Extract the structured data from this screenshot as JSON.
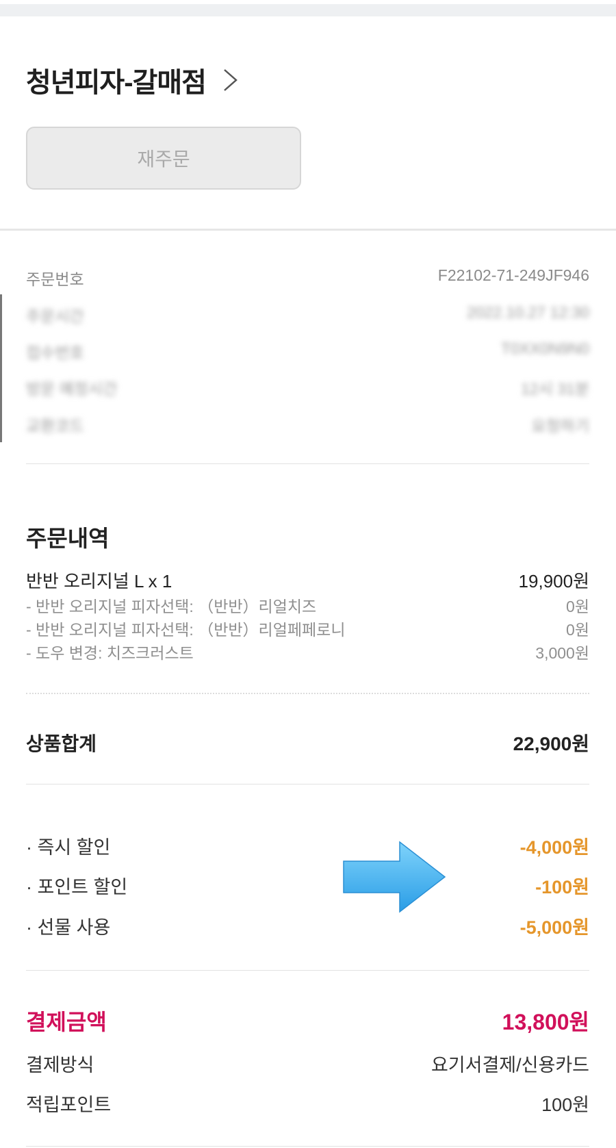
{
  "store": {
    "name": "청년피자-갈매점"
  },
  "reorder_label": "재주문",
  "order_info": [
    {
      "label": "주문번호",
      "value": "F22102-71-249JF946",
      "blurred": false
    },
    {
      "label": "주문시간",
      "value": "2022.10.27 12:30",
      "blurred": true
    },
    {
      "label": "접수번호",
      "value": "T0XX0N9N0",
      "blurred": true
    },
    {
      "label": "방문 예정시간",
      "value": "12시 31분",
      "blurred": true
    },
    {
      "label": "교환코드",
      "value": "요청하기",
      "blurred": true
    }
  ],
  "order_details": {
    "title": "주문내역",
    "item": {
      "name": "반반 오리지널 L x 1",
      "price": "19,900원"
    },
    "options": [
      {
        "label": "- 반반 오리지널 피자선택: （반반）리얼치즈",
        "price": "0원"
      },
      {
        "label": "- 반반 오리지널 피자선택: （반반）리얼페페로니",
        "price": "0원"
      },
      {
        "label": "- 도우 변경: 치즈크러스트",
        "price": "3,000원"
      }
    ]
  },
  "subtotal": {
    "label": "상품합계",
    "value": "22,900원"
  },
  "discounts": [
    {
      "label": "· 즉시 할인",
      "value": "-4,000원"
    },
    {
      "label": "· 포인트 할인",
      "value": "-100원"
    },
    {
      "label": "· 선물 사용",
      "value": "-5,000원"
    }
  ],
  "payment": {
    "amount_label": "결제금액",
    "amount_value": "13,800원",
    "method_label": "결제방식",
    "method_value": "요기서결제/신용카드",
    "points_label": "적립포인트",
    "points_value": "100원"
  },
  "colors": {
    "accent": "#d1105a",
    "discount": "#e5962b",
    "arrow": "#3fb3f0"
  }
}
